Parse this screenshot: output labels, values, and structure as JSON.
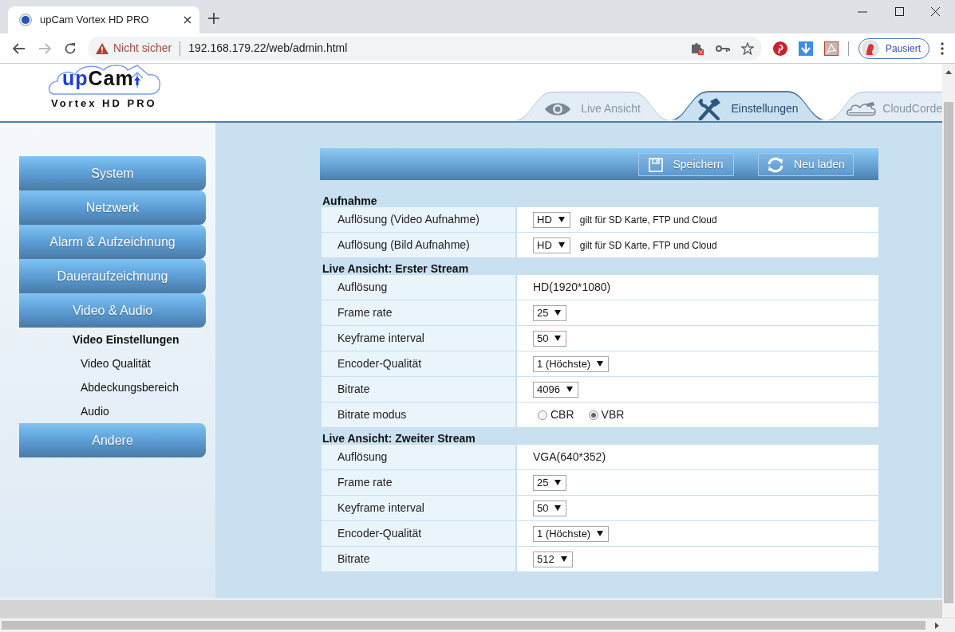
{
  "browser": {
    "tab_title": "upCam Vortex HD PRO",
    "security_label": "Nicht sicher",
    "url": "192.168.179.22/web/admin.html",
    "profile": "Pausiert"
  },
  "logo": {
    "brand_parts": [
      "up",
      "Cam"
    ],
    "model": "Vortex HD PRO"
  },
  "tabs": [
    {
      "label": "Live Ansicht",
      "kind": "eye",
      "selected": false
    },
    {
      "label": "Einstellungen",
      "kind": "tools",
      "selected": true
    },
    {
      "label": "CloudCorde",
      "kind": "cloud",
      "selected": false
    }
  ],
  "sidebar": {
    "items": [
      {
        "label": "System"
      },
      {
        "label": "Netzwerk"
      },
      {
        "label": "Alarm & Aufzeichnung"
      },
      {
        "label": "Daueraufzeichnung"
      },
      {
        "label": "Video & Audio",
        "children": [
          {
            "label": "Video Einstellungen",
            "selected": true
          },
          {
            "label": "Video Qualität",
            "selected": false
          },
          {
            "label": "Abdeckungsbereich",
            "selected": false
          },
          {
            "label": "Audio",
            "selected": false
          }
        ]
      },
      {
        "label": "Andere"
      }
    ]
  },
  "toolbar": {
    "buttons": [
      {
        "label": "Speichern",
        "kind": "save"
      },
      {
        "label": "Neu laden",
        "kind": "reload"
      }
    ]
  },
  "sections": [
    {
      "title": "Aufnahme",
      "rows": [
        {
          "label": "Auflösung (Video Aufnahme)",
          "kind": "select",
          "value": "HD",
          "note": "gilt für SD Karte, FTP und Cloud"
        },
        {
          "label": "Auflösung (Bild Aufnahme)",
          "kind": "select",
          "value": "HD",
          "note": "gilt für SD Karte, FTP und Cloud"
        }
      ]
    },
    {
      "title": "Live Ansicht: Erster Stream",
      "rows": [
        {
          "label": "Auflösung",
          "kind": "text",
          "value": "HD(1920*1080)"
        },
        {
          "label": "Frame rate",
          "kind": "select",
          "value": "25"
        },
        {
          "label": "Keyframe interval",
          "kind": "select",
          "value": "50"
        },
        {
          "label": "Encoder-Qualität",
          "kind": "select",
          "value": "1 (Höchste)"
        },
        {
          "label": "Bitrate",
          "kind": "select",
          "value": "4096"
        },
        {
          "label": "Bitrate modus",
          "kind": "radio",
          "options": [
            {
              "label": "CBR",
              "selected": false
            },
            {
              "label": "VBR",
              "selected": true
            }
          ]
        }
      ]
    },
    {
      "title": "Live Ansicht: Zweiter Stream",
      "rows": [
        {
          "label": "Auflösung",
          "kind": "text",
          "value": "VGA(640*352)"
        },
        {
          "label": "Frame rate",
          "kind": "select",
          "value": "25"
        },
        {
          "label": "Keyframe interval",
          "kind": "select",
          "value": "50"
        },
        {
          "label": "Encoder-Qualität",
          "kind": "select",
          "value": "1 (Höchste)"
        },
        {
          "label": "Bitrate",
          "kind": "select",
          "value": "512"
        }
      ]
    }
  ]
}
